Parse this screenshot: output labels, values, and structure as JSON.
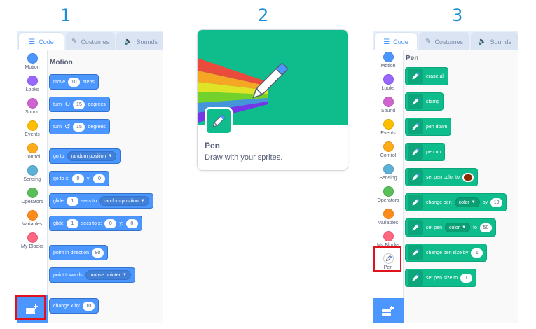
{
  "steps": [
    "1",
    "2",
    "3"
  ],
  "tabs": {
    "code": "Code",
    "costumes": "Costumes",
    "sounds": "Sounds"
  },
  "categories": {
    "motion": "Motion",
    "looks": "Looks",
    "sound": "Sound",
    "events": "Events",
    "control": "Control",
    "sensing": "Sensing",
    "operators": "Operators",
    "variables": "Variables",
    "my_blocks": "My Blocks",
    "pen": "Pen"
  },
  "category_colors": {
    "motion": "#4c97ff",
    "looks": "#9966ff",
    "sound": "#cf63cf",
    "events": "#ffbf00",
    "control": "#ffab19",
    "sensing": "#5cb1d6",
    "operators": "#59c059",
    "variables": "#ff8c1a",
    "my_blocks": "#ff6680",
    "pen": "#0fbd8c"
  },
  "motion_palette": {
    "heading": "Motion",
    "move": {
      "label": "move",
      "value": "10",
      "suffix": "steps"
    },
    "turn_right": {
      "label": "turn",
      "value": "15",
      "suffix": "degrees"
    },
    "turn_left": {
      "label": "turn",
      "value": "15",
      "suffix": "degrees"
    },
    "go_to": {
      "label": "go to",
      "option": "random position"
    },
    "go_to_xy": {
      "label": "go to x:",
      "x": "0",
      "y_label": "y:",
      "y": "0"
    },
    "glide_to": {
      "label": "glide",
      "value": "1",
      "mid": "secs to",
      "option": "random position"
    },
    "glide_xy": {
      "label": "glide",
      "value": "1",
      "mid": "secs to x:",
      "x": "0",
      "y_label": "y:",
      "y": "0"
    },
    "point_dir": {
      "label": "point in direction",
      "value": "90"
    },
    "point_towards": {
      "label": "point towards",
      "option": "mouse pointer"
    },
    "change_x": {
      "label": "change x by",
      "value": "10"
    }
  },
  "extension_card": {
    "title": "Pen",
    "description": "Draw with your sprites."
  },
  "pen_palette": {
    "heading": "Pen",
    "erase_all": "erase all",
    "stamp": "stamp",
    "pen_down": "pen down",
    "pen_up": "pen up",
    "set_color": {
      "label": "set pen color to",
      "swatch": "#8b2a00"
    },
    "change_param": {
      "label": "change pen",
      "option": "color",
      "mid": "by",
      "value": "10"
    },
    "set_param": {
      "label": "set pen",
      "option": "color",
      "mid": "to",
      "value": "50"
    },
    "change_size": {
      "label": "change pen size by",
      "value": "1"
    },
    "set_size": {
      "label": "set pen size to",
      "value": "1"
    }
  }
}
